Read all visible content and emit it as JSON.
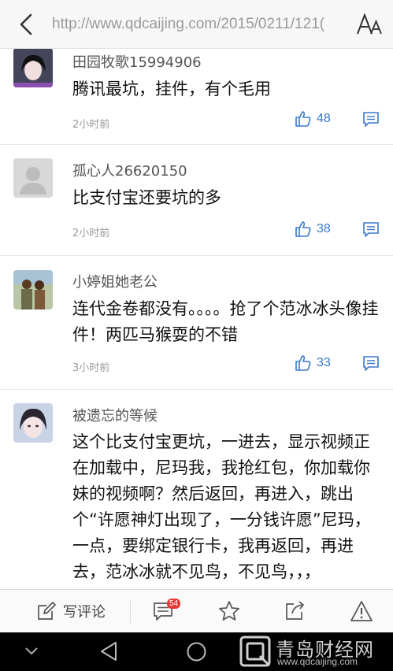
{
  "browser": {
    "url": "http://www.qdcaijing.com/2015/0211/121("
  },
  "comments": [
    {
      "user": "田园牧歌15994906",
      "text": "腾讯最坑，挂件，有个毛用",
      "time": "2小时前",
      "likes": "48",
      "avatar": "girl-portrait-avatar"
    },
    {
      "user": "孤心人26620150",
      "text": "比支付宝还要坑的多",
      "time": "2小时前",
      "likes": "38",
      "avatar": "default-user-avatar"
    },
    {
      "user": "小婷姐她老公",
      "text": "连代金卷都没有。。。。抢了个范冰冰头像挂件！两匹马猴耍的不错",
      "time": "3小时前",
      "likes": "33",
      "avatar": "couple-photo-avatar"
    },
    {
      "user": "被遗忘的等候",
      "text": "这个比支付宝更坑，一进去，显示视频正在加载中，尼玛我，我抢红包，你加载你妹的视频啊？然后返回，再进入，跳出个“许愿神灯出现了，一分钱许愿”尼玛，一点，要绑定银行卡，我再返回，再进去，范冰冰就不见鸟，不见鸟，，，",
      "time": "",
      "likes": "",
      "avatar": "girl-portrait-avatar"
    }
  ],
  "toolbar": {
    "write_label": "写评论",
    "comment_count": "54"
  },
  "watermark": {
    "title": "青岛财经网",
    "url": "www.qdcaijing.com"
  },
  "colors": {
    "like_blue": "#3a78c8",
    "badge_red": "#e53935"
  }
}
